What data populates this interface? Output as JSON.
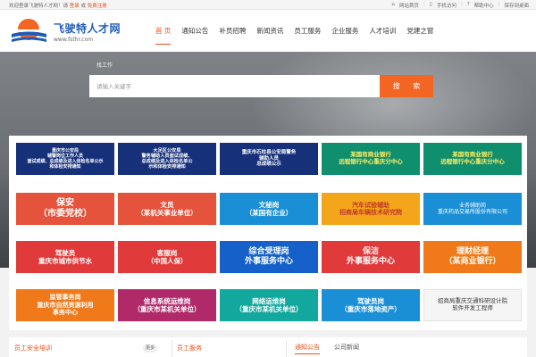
{
  "topbar": {
    "welcome": "欢迎登录飞驶特人才网！请",
    "login": "登录",
    "or": "或",
    "register": "免费注册",
    "links": [
      "网站首页",
      "手机访问",
      "帮助中心",
      "保存到桌面"
    ]
  },
  "header": {
    "brand": "飞驶特人才网",
    "domain": "www.fsthr.com",
    "nav": [
      "首 页",
      "通知公告",
      "补员招聘",
      "新闻资讯",
      "员工服务",
      "企业服务",
      "人才培训",
      "党建之窗"
    ],
    "active_index": 0,
    "accent": "#e8501a",
    "brand_color": "#1e5bb8"
  },
  "hero": {
    "tab": "找工作",
    "placeholder": "请输入关键字",
    "search_label": "搜 索",
    "button_color": "#f26522"
  },
  "tiles": [
    {
      "text": "重庆市公安局\n辅警岗位工作人员\n面试成绩、总成绩及进入体检名单公示\n和体检安排通知",
      "bg": "#16307a",
      "color": "#ffffff",
      "style": "notice"
    },
    {
      "text": "大足区公安局\n警务辅助人员面试成绩、\n总成绩及进入体检名单公\n示和体检安排通知",
      "bg": "#16307a",
      "color": "#ffffff",
      "style": "notice2"
    },
    {
      "text": "重庆市石柱县公安局警务\n辅助人员\n总成绩公示",
      "bg": "#16307a",
      "color": "#ffffff",
      "style": "notice3"
    },
    {
      "text": "某国有商业银行\n远程银行中心重庆分中心",
      "bg": "#0f8f6e",
      "color": "#ffee66",
      "style": "bank"
    },
    {
      "text": "某国有商业银行\n远程银行中心重庆分中心",
      "bg": "#0f8f6e",
      "color": "#ffee66",
      "style": "bank"
    },
    {
      "text": "保安\n（市委党校）",
      "bg": "#e5533c",
      "color": "#ffffff",
      "style": "big"
    },
    {
      "text": "文员\n（某机关事业单位）",
      "bg": "#e5533c",
      "color": "#ffffff",
      "style": "mid"
    },
    {
      "text": "文秘岗\n（某国有企业）",
      "bg": "#1a8fd6",
      "color": "#ffffff",
      "style": "mid"
    },
    {
      "text": "汽车试验辅助\n招商局车辆技术研究院",
      "bg": "#f4a61a",
      "color": "#c0392b",
      "style": "car"
    },
    {
      "text": "业务辅助岗\n重庆药品交易所股份有限公司",
      "bg": "#1a8fd6",
      "color": "#ffffff",
      "style": "small"
    },
    {
      "text": "驾驶员\n重庆市城市供节水",
      "bg": "#e03a3a",
      "color": "#ffffff",
      "style": "mid"
    },
    {
      "text": "客服岗\n（中国人保）",
      "bg": "#e03a3a",
      "color": "#ffffff",
      "style": "mid"
    },
    {
      "text": "综合受理岗\n外事服务中心",
      "bg": "#1561c9",
      "color": "#ffffff",
      "style": "big2"
    },
    {
      "text": "保洁\n外事服务中心",
      "bg": "#e03a3a",
      "color": "#ffffff",
      "style": "big2"
    },
    {
      "text": "理财经理\n（某商业银行）",
      "bg": "#f07a1a",
      "color": "#ffffff",
      "style": "big2"
    },
    {
      "text": "监管事务岗\n重庆市自然资源利用\n事务中心",
      "bg": "#f07a1a",
      "color": "#ffffff",
      "style": "mid3"
    },
    {
      "text": "信息系统运维岗\n（重庆市某机关单位）",
      "bg": "#b02a6a",
      "color": "#ffffff",
      "style": "mid"
    },
    {
      "text": "网络运维岗\n（重庆市某机关单位）",
      "bg": "#13a89e",
      "color": "#ffffff",
      "style": "mid"
    },
    {
      "text": "驾驶员岗\n（重庆市落地资产）",
      "bg": "#1a8fd6",
      "color": "#ffffff",
      "style": "mid"
    },
    {
      "text": "招商局重庆交通科研设计院\n软件开发工程师",
      "bg": "#f5f5f5",
      "color": "#333333",
      "style": "plain"
    }
  ],
  "bottom": {
    "col1_title": "员工安全培训",
    "col1_more": "更多",
    "col2_title": "员工服务",
    "tabs": [
      "通知公告",
      "公司新闻"
    ]
  }
}
